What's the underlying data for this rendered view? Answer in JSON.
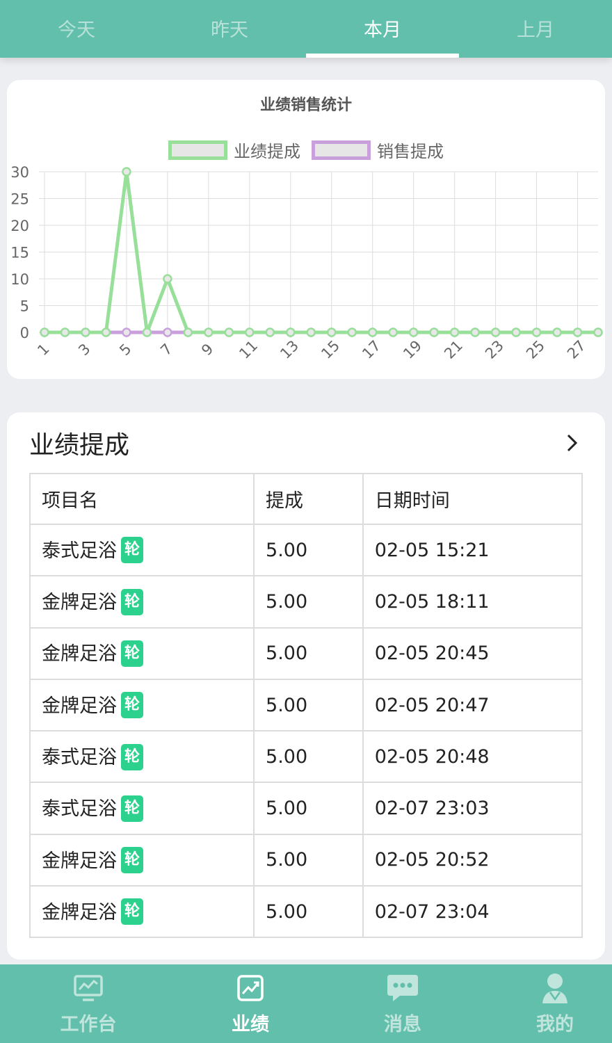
{
  "top_tabs": [
    {
      "label": "今天",
      "active": false
    },
    {
      "label": "昨天",
      "active": false
    },
    {
      "label": "本月",
      "active": true
    },
    {
      "label": "上月",
      "active": false
    }
  ],
  "chart_card": {
    "title": "业绩销售统计",
    "legend": [
      {
        "label": "业绩提成",
        "color": "#98e09a"
      },
      {
        "label": "销售提成",
        "color": "#c9a0dc"
      }
    ]
  },
  "chart_data": {
    "type": "line",
    "title": "业绩销售统计",
    "x": [
      1,
      2,
      3,
      4,
      5,
      6,
      7,
      8,
      9,
      10,
      11,
      12,
      13,
      14,
      15,
      16,
      17,
      18,
      19,
      20,
      21,
      22,
      23,
      24,
      25,
      26,
      27,
      28
    ],
    "x_tick_labels": [
      "1",
      "3",
      "5",
      "7",
      "9",
      "11",
      "13",
      "15",
      "17",
      "19",
      "21",
      "23",
      "25",
      "27"
    ],
    "ylim": [
      0,
      30
    ],
    "y_ticks": [
      0,
      5,
      10,
      15,
      20,
      25,
      30
    ],
    "grid": true,
    "legend_position": "top-center",
    "series": [
      {
        "name": "业绩提成",
        "color": "#98e09a",
        "values": [
          0,
          0,
          0,
          0,
          30,
          0,
          10,
          0,
          0,
          0,
          0,
          0,
          0,
          0,
          0,
          0,
          0,
          0,
          0,
          0,
          0,
          0,
          0,
          0,
          0,
          0,
          0,
          0
        ]
      },
      {
        "name": "销售提成",
        "color": "#c9a0dc",
        "values": [
          0,
          0,
          0,
          0,
          0,
          0,
          0,
          0,
          0,
          0,
          0,
          0,
          0,
          0,
          0,
          0,
          0,
          0,
          0,
          0,
          0,
          0,
          0,
          0,
          0,
          0,
          0,
          0
        ]
      }
    ]
  },
  "performance": {
    "title": "业绩提成",
    "columns": [
      "项目名",
      "提成",
      "日期时间"
    ],
    "badge_text": "轮",
    "rows": [
      {
        "name": "泰式足浴",
        "commission": "5.00",
        "datetime": "02-05 15:21"
      },
      {
        "name": "金牌足浴",
        "commission": "5.00",
        "datetime": "02-05 18:11"
      },
      {
        "name": "金牌足浴",
        "commission": "5.00",
        "datetime": "02-05 20:45"
      },
      {
        "name": "金牌足浴",
        "commission": "5.00",
        "datetime": "02-05 20:47"
      },
      {
        "name": "泰式足浴",
        "commission": "5.00",
        "datetime": "02-05 20:48"
      },
      {
        "name": "泰式足浴",
        "commission": "5.00",
        "datetime": "02-07 23:03"
      },
      {
        "name": "金牌足浴",
        "commission": "5.00",
        "datetime": "02-05 20:52"
      },
      {
        "name": "金牌足浴",
        "commission": "5.00",
        "datetime": "02-07 23:04"
      }
    ]
  },
  "bottom_nav": [
    {
      "label": "工作台",
      "icon": "monitor-icon",
      "active": false
    },
    {
      "label": "业绩",
      "icon": "trend-chart-icon",
      "active": true
    },
    {
      "label": "消息",
      "icon": "chat-bubble-icon",
      "active": false
    },
    {
      "label": "我的",
      "icon": "user-icon",
      "active": false
    }
  ],
  "colors": {
    "brand": "#62bfab",
    "badge": "#2bd18c",
    "series_primary": "#98e09a",
    "series_secondary": "#c9a0dc"
  }
}
